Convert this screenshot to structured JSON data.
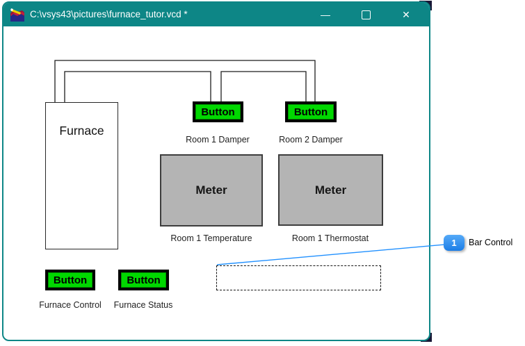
{
  "window": {
    "title": "C:\\vsys43\\pictures\\furnace_tutor.vcd *",
    "app_icon": "vissim-diagram-pencil-icon",
    "controls": {
      "minimize_glyph": "—",
      "maximize_icon": "outline-square",
      "close_glyph": "✕"
    }
  },
  "canvas": {
    "furnace_label": "Furnace",
    "widgets": {
      "room1_damper": {
        "label": "Button",
        "caption": "Room 1 Damper"
      },
      "room2_damper": {
        "label": "Button",
        "caption": "Room 2 Damper"
      },
      "room1_temperature": {
        "label": "Meter",
        "caption": "Room 1 Temperature"
      },
      "room1_thermostat": {
        "label": "Meter",
        "caption": "Room 1 Thermostat"
      },
      "furnace_control": {
        "label": "Button",
        "caption": "Furnace Control"
      },
      "furnace_status": {
        "label": "Button",
        "caption": "Furnace Status"
      },
      "bar_control": {
        "caption": ""
      }
    }
  },
  "callout": {
    "number": "1",
    "label": "Bar Control"
  },
  "colors": {
    "titlebar_teal": "#0d8686",
    "button_green": "#00d800",
    "meter_gray": "#b4b4b4",
    "callout_blue": "#2090ff",
    "corner_artifact_navy": "#181836"
  }
}
